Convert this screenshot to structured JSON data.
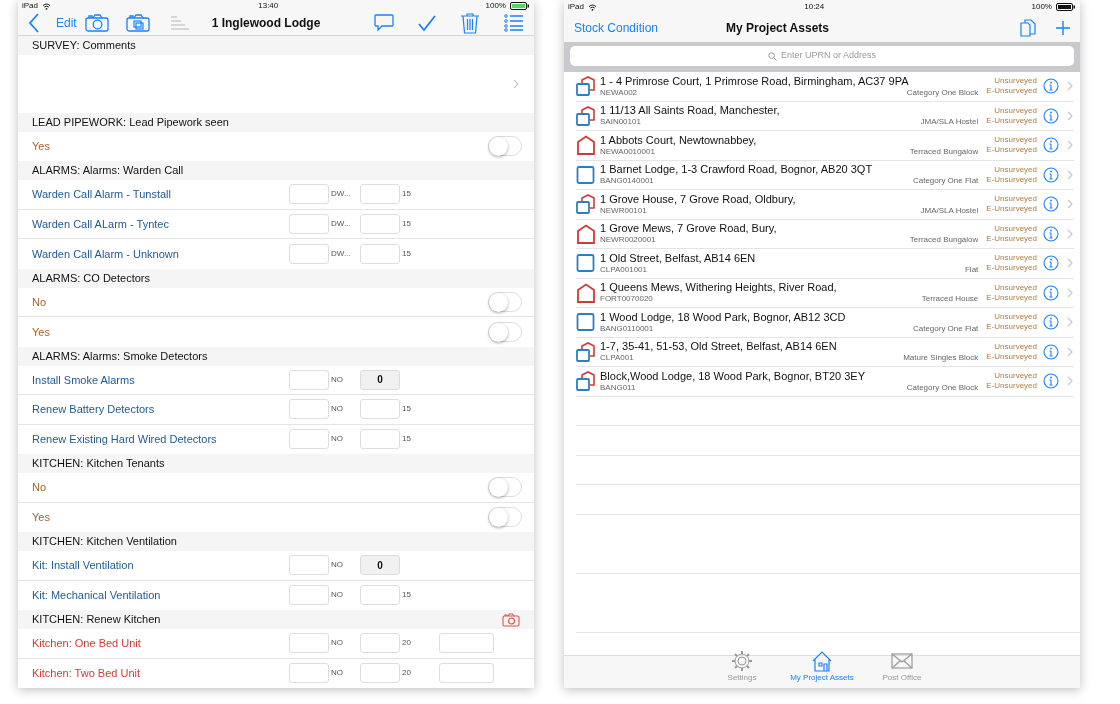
{
  "survey_screen": {
    "status_bar": {
      "device": "iPad",
      "time": "13:40",
      "battery": "100%"
    },
    "nav": {
      "edit": "Edit",
      "title": "1  Inglewood Lodge"
    },
    "sections": [
      {
        "title": "SURVEY: Comments",
        "camera": false,
        "rows": [
          {
            "kind": "comment"
          }
        ]
      },
      {
        "title": "LEAD PIPEWORK: Lead Pipework seen",
        "camera": false,
        "rows": [
          {
            "kind": "toggle",
            "label": "Yes",
            "on": false
          }
        ]
      },
      {
        "title": "ALARMS: Alarms: Warden Call",
        "camera": false,
        "rows": [
          {
            "kind": "entry",
            "label": "Warden Call Alarm - Tunstall",
            "color": "#1f5a91",
            "unit": "DW...",
            "life": "15",
            "extra_box": false
          },
          {
            "kind": "entry",
            "label": "Warden Call ALarm - Tyntec",
            "color": "#1f5a91",
            "unit": "DW...",
            "life": "15",
            "extra_box": false
          },
          {
            "kind": "entry",
            "label": "Warden Call Alarm - Unknown",
            "color": "#1f5a91",
            "unit": "DW...",
            "life": "15",
            "extra_box": false
          }
        ]
      },
      {
        "title": "ALARMS: CO Detectors",
        "camera": false,
        "rows": [
          {
            "kind": "toggle",
            "label": "No",
            "on": false
          },
          {
            "kind": "toggle",
            "label": "Yes",
            "on": false
          }
        ]
      },
      {
        "title": "ALARMS: Alarms: Smoke Detectors",
        "camera": false,
        "rows": [
          {
            "kind": "entry",
            "label": "Install Smoke Alarms",
            "color": "#1f5a91",
            "unit": "NO",
            "value": "0",
            "extra_box": false
          },
          {
            "kind": "entry",
            "label": "Renew Battery Detectors",
            "color": "#1f5a91",
            "unit": "NO",
            "life": "15",
            "extra_box": false
          },
          {
            "kind": "entry",
            "label": "Renew Existing Hard Wired Detectors",
            "color": "#1f5a91",
            "unit": "NO",
            "life": "15",
            "extra_box": false
          }
        ]
      },
      {
        "title": "KITCHEN: Kitchen Tenants",
        "camera": false,
        "rows": [
          {
            "kind": "toggle",
            "label": "No",
            "on": false
          },
          {
            "kind": "toggle",
            "label": "Yes",
            "on": false
          }
        ]
      },
      {
        "title": "KITCHEN: Kitchen Ventilation",
        "camera": false,
        "rows": [
          {
            "kind": "entry",
            "label": "Kit: Install Ventilation",
            "color": "#1f5a91",
            "unit": "NO",
            "value": "0",
            "extra_box": false
          },
          {
            "kind": "entry",
            "label": "Kit: Mechanical Ventilation",
            "color": "#1f5a91",
            "unit": "NO",
            "life": "15",
            "extra_box": false
          }
        ]
      },
      {
        "title": "KITCHEN: Renew Kitchen",
        "camera": true,
        "rows": [
          {
            "kind": "entry",
            "label": "Kitchen: One Bed Unit",
            "color": "#d23a36",
            "unit": "NO",
            "life": "20",
            "extra_box": true
          },
          {
            "kind": "entry",
            "label": "Kitchen: Two Bed Unit",
            "color": "#d23a36",
            "unit": "NO",
            "life": "20",
            "extra_box": true
          }
        ]
      }
    ]
  },
  "assets_screen": {
    "status_bar": {
      "device": "iPad",
      "time": "10:24",
      "battery": "100%"
    },
    "nav": {
      "back": "Stock Condition",
      "title": "My Project Assets"
    },
    "search": {
      "placeholder": "Enter UPRN or Address"
    },
    "assets": [
      {
        "kind": "block",
        "address": "1 - 4 Primrose Court, 1 Primrose Road, Birmingham, AC37 9PA",
        "code": "NEWA002",
        "type": "Category One Block",
        "status": "Unsurveyed",
        "e_status": "E-Unsurveyed"
      },
      {
        "kind": "block",
        "address": "1 11/13 All Saints Road, Manchester,",
        "code": "SAIN00101",
        "type": "JMA/SLA Hostel",
        "status": "Unsurveyed",
        "e_status": "E-Unsurveyed"
      },
      {
        "kind": "house",
        "address": "1 Abbots Court, Newtownabbey,",
        "code": "NEWA0010001",
        "type": "Terraced Bungalow",
        "status": "Unsurveyed",
        "e_status": "E-Unsurveyed"
      },
      {
        "kind": "flat",
        "address": "1 Barnet Lodge, 1-3 Crawford Road, Bognor, AB20 3QT",
        "code": "BANG0140001",
        "type": "Category One Flat",
        "status": "Unsurveyed",
        "e_status": "E-Unsurveyed"
      },
      {
        "kind": "block",
        "address": "1 Grove House, 7 Grove Road,  Oldbury,",
        "code": "NEWR00101",
        "type": "JMA/SLA Hostel",
        "status": "Unsurveyed",
        "e_status": "E-Unsurveyed"
      },
      {
        "kind": "house",
        "address": "1 Grove Mews, 7 Grove Road, Bury,",
        "code": "NEWR0020001",
        "type": "Terraced Bungalow",
        "status": "Unsurveyed",
        "e_status": "E-Unsurveyed"
      },
      {
        "kind": "flat",
        "address": "1 Old Street, Belfast, AB14 6EN",
        "code": "CLPA001001",
        "type": "Flat",
        "status": "Unsurveyed",
        "e_status": "E-Unsurveyed"
      },
      {
        "kind": "house",
        "address": "1 Queens Mews, Withering Heights, River Road,",
        "code": "FORT0070020",
        "type": "Terraced House",
        "status": "Unsurveyed",
        "e_status": "E-Unsurveyed"
      },
      {
        "kind": "flat",
        "address": "1 Wood Lodge, 18 Wood Park, Bognor, AB12 3CD",
        "code": "BANG0110001",
        "type": "Category One Flat",
        "status": "Unsurveyed",
        "e_status": "E-Unsurveyed"
      },
      {
        "kind": "block",
        "address": "1-7, 35-41, 51-53, Old Street, Belfast, AB14 6EN",
        "code": "CLPA001",
        "type": "Mature Singles Block",
        "status": "Unsurveyed",
        "e_status": "E-Unsurveyed"
      },
      {
        "kind": "block",
        "address": "Block,Wood Lodge, 18 Wood Park, Bognor, BT20 3EY",
        "code": "BANG011",
        "type": "Category One Block",
        "status": "Unsurveyed",
        "e_status": "E-Unsurveyed"
      }
    ],
    "tabs": [
      {
        "kind": "settings",
        "label": "Settings",
        "selected": false
      },
      {
        "kind": "assets",
        "label": "My Project Assets",
        "selected": true
      },
      {
        "kind": "post",
        "label": "Post Office",
        "selected": false
      }
    ]
  }
}
